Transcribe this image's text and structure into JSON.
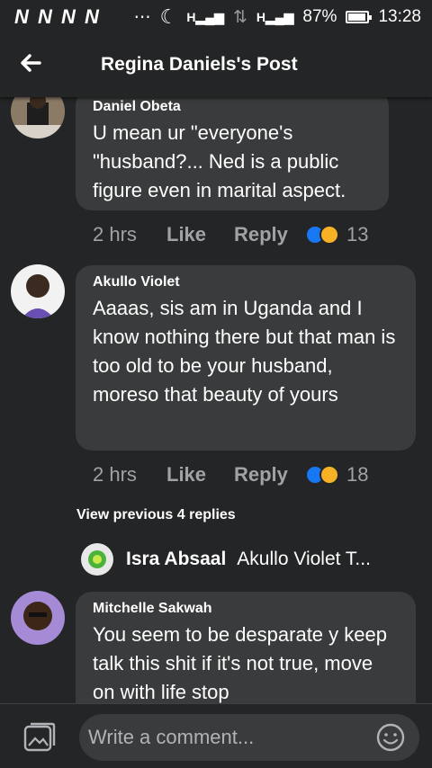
{
  "status_bar": {
    "carrier_icons": "N N N N",
    "dots": "⋯",
    "battery": "87%",
    "time": "13:28"
  },
  "header": {
    "title": "Regina Daniels's Post"
  },
  "comments": [
    {
      "author": "Daniel Obeta",
      "text": "U mean ur \"everyone's \"husband?... Ned is a public figure even in marital aspect.",
      "time": "2 hrs",
      "like_label": "Like",
      "reply_label": "Reply",
      "reaction_count": "13"
    },
    {
      "author": "Akullo Violet",
      "text": "Aaaas, sis am in Uganda and I know nothing there but that man is too old to be your husband, moreso that beauty of yours",
      "time": "2 hrs",
      "like_label": "Like",
      "reply_label": "Reply",
      "reaction_count": "18"
    },
    {
      "author": "Mitchelle Sakwah",
      "text": "You seem to be desparate y keep talk this shit if it's not true, move on with life stop"
    }
  ],
  "replies": {
    "view_previous": "View previous 4 replies",
    "preview_name": "Isra Absaal",
    "preview_text": "Akullo Violet T..."
  },
  "composer": {
    "placeholder": "Write a comment..."
  },
  "colors": {
    "background": "#242526",
    "bubble": "#3a3b3c",
    "like_reaction": "#1877f2",
    "haha_reaction": "#f7b125"
  }
}
